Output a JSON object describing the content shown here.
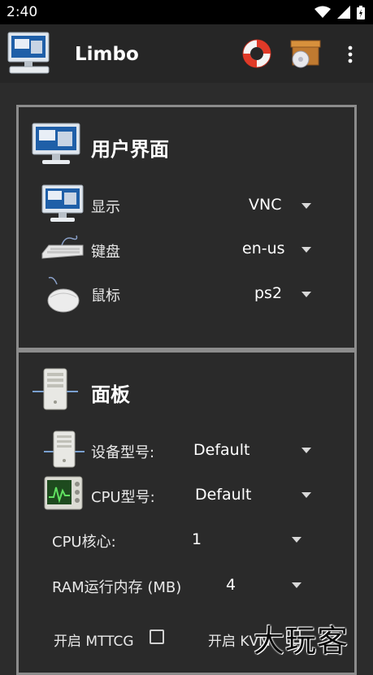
{
  "status_bar": {
    "time": "2:40"
  },
  "app_bar": {
    "title": "Limbo"
  },
  "ui_section": {
    "title": "用户界面",
    "rows": [
      {
        "label": "显示",
        "value": "VNC"
      },
      {
        "label": "键盘",
        "value": "en-us"
      },
      {
        "label": "鼠标",
        "value": "ps2"
      }
    ]
  },
  "board_section": {
    "title": "面板",
    "machine_type": {
      "label": "设备型号:",
      "value": "Default"
    },
    "cpu_model": {
      "label": "CPU型号:",
      "value": "Default"
    },
    "cpu_cores": {
      "label": "CPU核心:",
      "value": "1"
    },
    "ram": {
      "label": "RAM运行内存 (MB)",
      "value": "4"
    },
    "mttcg_label": "开启 MTTCG",
    "kvm_label": "开启 KVM"
  },
  "watermark": "大玩客",
  "colors": {
    "background": "#2c2c2c",
    "app_bar": "#262626",
    "panel_border": "#8c8c8c"
  }
}
